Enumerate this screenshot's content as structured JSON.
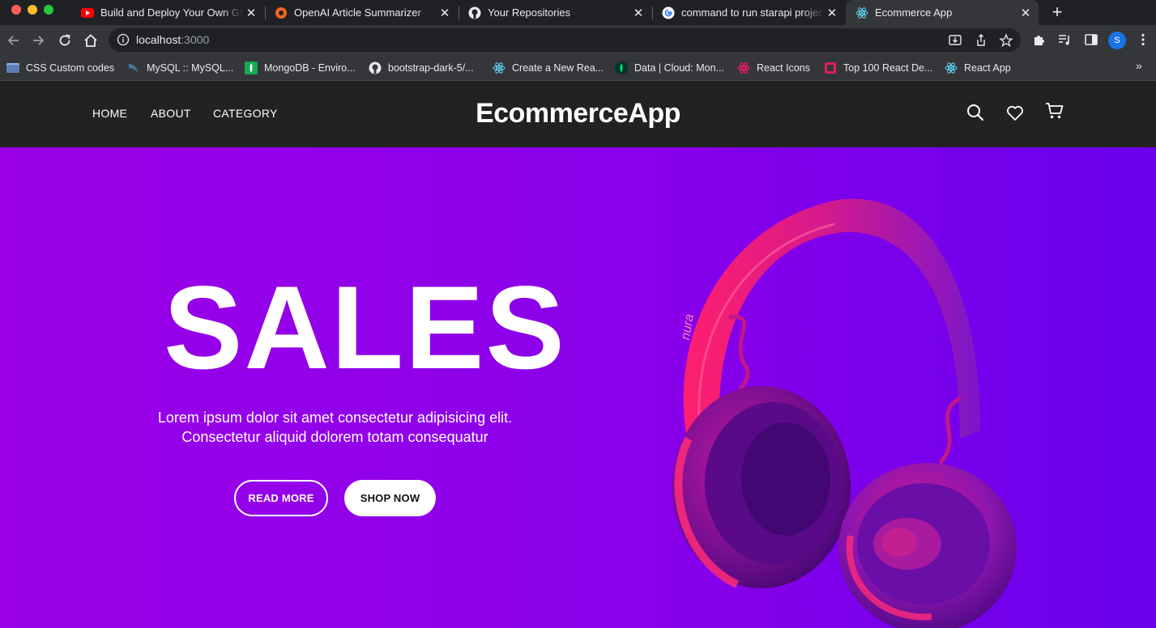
{
  "browser": {
    "tabs": [
      {
        "title": "Build and Deploy Your Own GPT",
        "icon": "youtube-icon",
        "active": false
      },
      {
        "title": "OpenAI Article Summarizer",
        "icon": "openai-summarizer-icon",
        "active": false
      },
      {
        "title": "Your Repositories",
        "icon": "github-icon",
        "active": false
      },
      {
        "title": "command to run starapi project",
        "icon": "google-icon",
        "active": false
      },
      {
        "title": "Ecommerce App",
        "icon": "react-icon",
        "active": true
      }
    ],
    "address": {
      "host": "localhost",
      "port": ":3000"
    },
    "profile_initial": "S",
    "bookmarks": [
      {
        "label": "CSS Custom codes",
        "icon": "folder-icon"
      },
      {
        "label": "MySQL :: MySQL...",
        "icon": "mysql-icon"
      },
      {
        "label": "MongoDB - Enviro...",
        "icon": "mongodb-icon"
      },
      {
        "label": "bootstrap-dark-5/...",
        "icon": "github-icon"
      },
      {
        "label": "Create a New Rea...",
        "icon": "react-icon"
      },
      {
        "label": "Data | Cloud: Mon...",
        "icon": "mongodb-leaf-icon"
      },
      {
        "label": "React Icons",
        "icon": "react-icons-icon"
      },
      {
        "label": "Top 100 React De...",
        "icon": "square-icon"
      },
      {
        "label": "React App",
        "icon": "react-icon"
      }
    ],
    "bookmarks_more": "»"
  },
  "site": {
    "nav": {
      "home": "HOME",
      "about": "ABOUT",
      "category": "CATEGORY"
    },
    "brand": "EcommerceApp",
    "nav_icons": [
      "search-icon",
      "heart-icon",
      "cart-icon"
    ]
  },
  "hero": {
    "title": "SALES",
    "description_line1": "Lorem ipsum dolor sit amet consectetur adipisicing elit.",
    "description_line2": "Consectetur aliquid dolorem totam consequatur",
    "read_more": "READ MORE",
    "shop_now": "SHOP NOW",
    "product_logo": "nura"
  },
  "colors": {
    "hero_gradient_start": "#9b00e8",
    "hero_gradient_end": "#6a00ec",
    "headphone_pink": "#ff1f6e",
    "nav_bg": "#222222"
  }
}
